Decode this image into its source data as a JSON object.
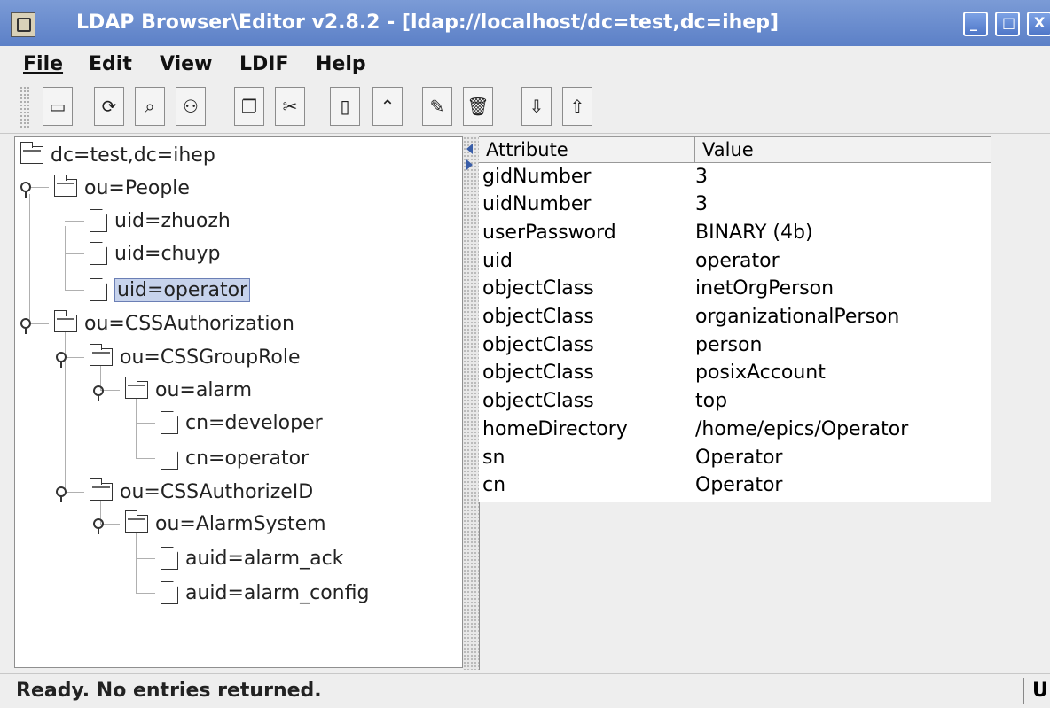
{
  "window": {
    "title": "LDAP Browser\\Editor v2.8.2 - [ldap://localhost/dc=test,dc=ihep]"
  },
  "menu": {
    "file": "File",
    "edit": "Edit",
    "view": "View",
    "ldif": "LDIF",
    "help": "Help"
  },
  "toolbar": [
    {
      "name": "connect-icon",
      "glyph": "▭"
    },
    {
      "name": "refresh-icon",
      "glyph": "⟳"
    },
    {
      "name": "search-icon",
      "glyph": "⌕"
    },
    {
      "name": "find-icon",
      "glyph": "⚇"
    },
    {
      "name": "copy-icon",
      "glyph": "❐"
    },
    {
      "name": "cut-icon",
      "glyph": "✂"
    },
    {
      "name": "paste-icon",
      "glyph": "▯"
    },
    {
      "name": "up-icon",
      "glyph": "⌃"
    },
    {
      "name": "edit-icon",
      "glyph": "✎"
    },
    {
      "name": "delete-icon",
      "glyph": "🗑"
    },
    {
      "name": "import-icon",
      "glyph": "⇩"
    },
    {
      "name": "export-icon",
      "glyph": "⇧"
    }
  ],
  "tree": [
    {
      "label": "dc=test,dc=ihep",
      "type": "folder"
    },
    {
      "label": "ou=People",
      "type": "folder"
    },
    {
      "label": "uid=zhuozh",
      "type": "doc"
    },
    {
      "label": "uid=chuyp",
      "type": "doc"
    },
    {
      "label": "uid=operator",
      "type": "doc"
    },
    {
      "label": "ou=CSSAuthorization",
      "type": "folder"
    },
    {
      "label": "ou=CSSGroupRole",
      "type": "folder"
    },
    {
      "label": "ou=alarm",
      "type": "folder"
    },
    {
      "label": "cn=developer",
      "type": "doc"
    },
    {
      "label": "cn=operator",
      "type": "doc"
    },
    {
      "label": "ou=CSSAuthorizeID",
      "type": "folder"
    },
    {
      "label": "ou=AlarmSystem",
      "type": "folder"
    },
    {
      "label": "auid=alarm_ack",
      "type": "doc"
    },
    {
      "label": "auid=alarm_config",
      "type": "doc"
    }
  ],
  "table": {
    "headers": {
      "attribute": "Attribute",
      "value": "Value"
    },
    "rows": [
      {
        "attr": "gidNumber",
        "value": "3"
      },
      {
        "attr": "uidNumber",
        "value": "3"
      },
      {
        "attr": "userPassword",
        "value": "BINARY (4b)"
      },
      {
        "attr": "uid",
        "value": "operator"
      },
      {
        "attr": "objectClass",
        "value": "inetOrgPerson"
      },
      {
        "attr": "objectClass",
        "value": "organizationalPerson"
      },
      {
        "attr": "objectClass",
        "value": "person"
      },
      {
        "attr": "objectClass",
        "value": "posixAccount"
      },
      {
        "attr": "objectClass",
        "value": "top"
      },
      {
        "attr": "homeDirectory",
        "value": "/home/epics/Operator"
      },
      {
        "attr": "sn",
        "value": "Operator"
      },
      {
        "attr": "cn",
        "value": "Operator"
      }
    ]
  },
  "status": {
    "message": "Ready. No entries returned.",
    "right": "U"
  }
}
